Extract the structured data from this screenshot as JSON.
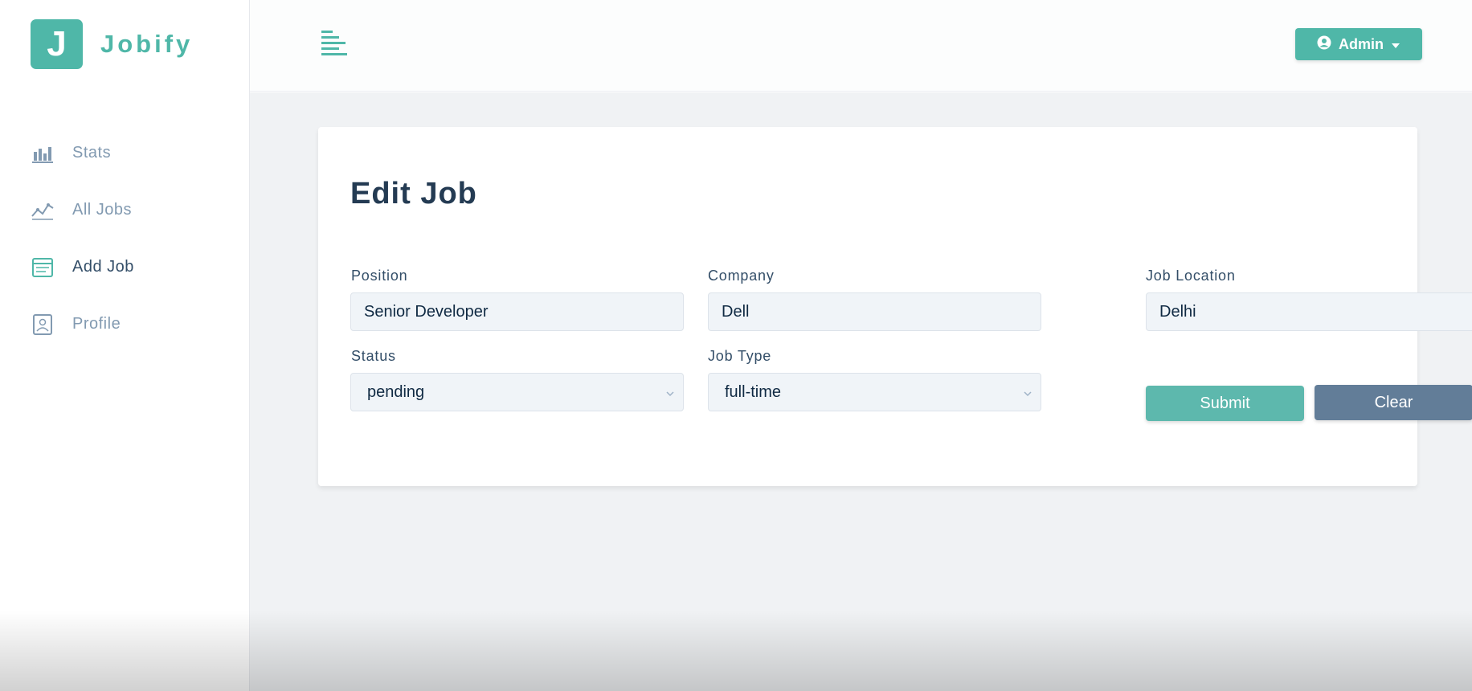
{
  "brand": {
    "logo_letter": "J",
    "name": "Jobify",
    "accent_color": "#4fb7a8"
  },
  "header": {
    "toggle_icon": "menu-icon",
    "user_button_label": "Admin",
    "user_icon": "user-circle-icon",
    "dropdown_icon": "caret-down-icon"
  },
  "sidebar": {
    "items": [
      {
        "label": "Stats",
        "icon": "bar-chart-icon",
        "active": false
      },
      {
        "label": "All Jobs",
        "icon": "chart-line-icon",
        "active": false
      },
      {
        "label": "Add Job",
        "icon": "form-icon",
        "active": true
      },
      {
        "label": "Profile",
        "icon": "id-card-icon",
        "active": false
      }
    ]
  },
  "form": {
    "title": "Edit Job",
    "position": {
      "label": "Position",
      "value": "Senior Developer"
    },
    "company": {
      "label": "Company",
      "value": "Dell"
    },
    "location": {
      "label": "Job Location",
      "value": "Delhi"
    },
    "status": {
      "label": "Status",
      "value": "pending"
    },
    "job_type": {
      "label": "Job Type",
      "value": "full-time"
    },
    "submit_label": "Submit",
    "clear_label": "Clear"
  }
}
